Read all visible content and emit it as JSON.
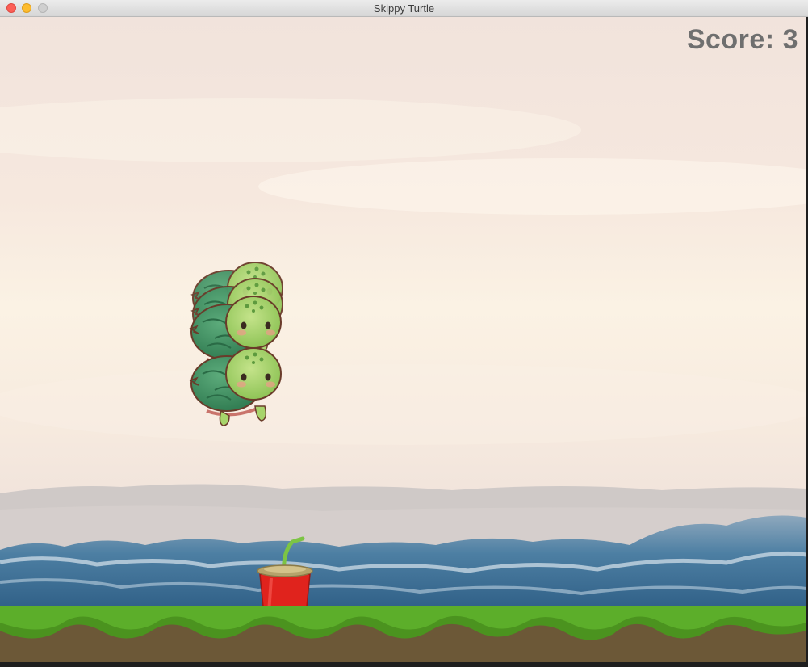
{
  "window": {
    "title": "Skippy Turtle"
  },
  "hud": {
    "score_label": "Score: 3"
  },
  "scene": {
    "sky_top_color": "#f3e4dc",
    "sky_mid_color": "#f8eee1",
    "sea_color": "#3e6f93",
    "grass_color": "#5cae2a",
    "dirt_color": "#6c5837",
    "cup_color": "#e0231d",
    "straw_color": "#7cc444",
    "turtle_shell_color": "#3e8f63",
    "turtle_skin_color": "#a7d46b"
  }
}
